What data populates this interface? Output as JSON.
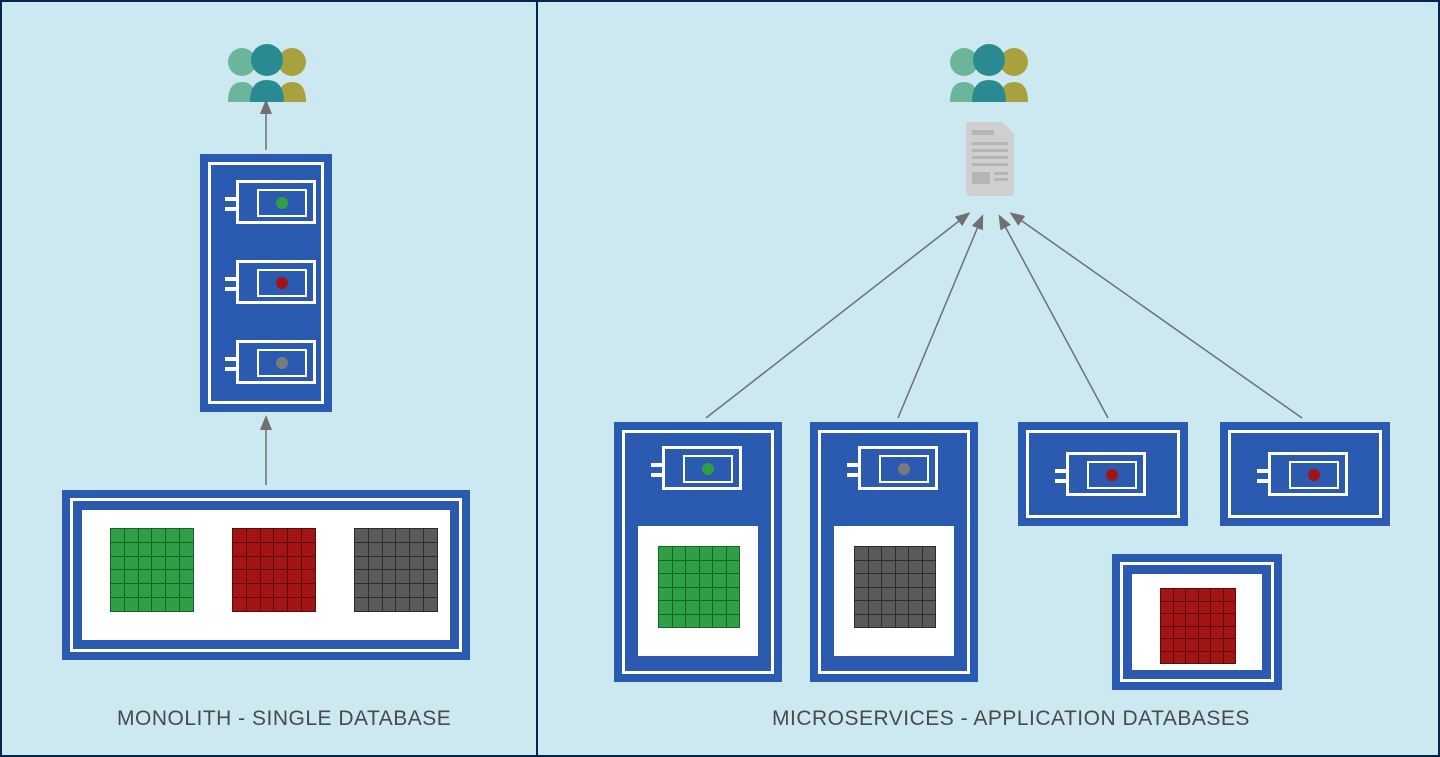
{
  "left": {
    "caption": "MONOLITH - SINGLE DATABASE",
    "app": {
      "modules": [
        {
          "name": "module-green",
          "dot_color": "green"
        },
        {
          "name": "module-red",
          "dot_color": "red"
        },
        {
          "name": "module-grey",
          "dot_color": "grey"
        }
      ]
    },
    "database": {
      "tables": [
        {
          "name": "table-green",
          "color": "green"
        },
        {
          "name": "table-red",
          "color": "red"
        },
        {
          "name": "table-grey",
          "color": "grey"
        }
      ]
    }
  },
  "right": {
    "caption": "MICROSERVICES - APPLICATION DATABASES",
    "gateway": "api-gateway",
    "services": [
      {
        "name": "service-green",
        "module_dot": "green",
        "has_db": true,
        "db_color": "green"
      },
      {
        "name": "service-grey",
        "module_dot": "grey",
        "has_db": true,
        "db_color": "grey"
      },
      {
        "name": "service-red-a",
        "module_dot": "red",
        "has_db": false
      },
      {
        "name": "service-red-b",
        "module_dot": "red",
        "has_db": false
      }
    ],
    "shared_db": {
      "name": "shared-red-db",
      "color": "red"
    }
  },
  "colors": {
    "panel_blue": "#2a5bb1",
    "bg": "#cce8f0",
    "border_dark": "#00274d",
    "green": "#2f9e44",
    "red": "#a31515",
    "grey": "#7a7a7a",
    "users_teal": "#2a8a92",
    "users_green": "#6bb59a",
    "users_olive": "#a9a13d",
    "doc_grey": "#b5b5b5"
  }
}
